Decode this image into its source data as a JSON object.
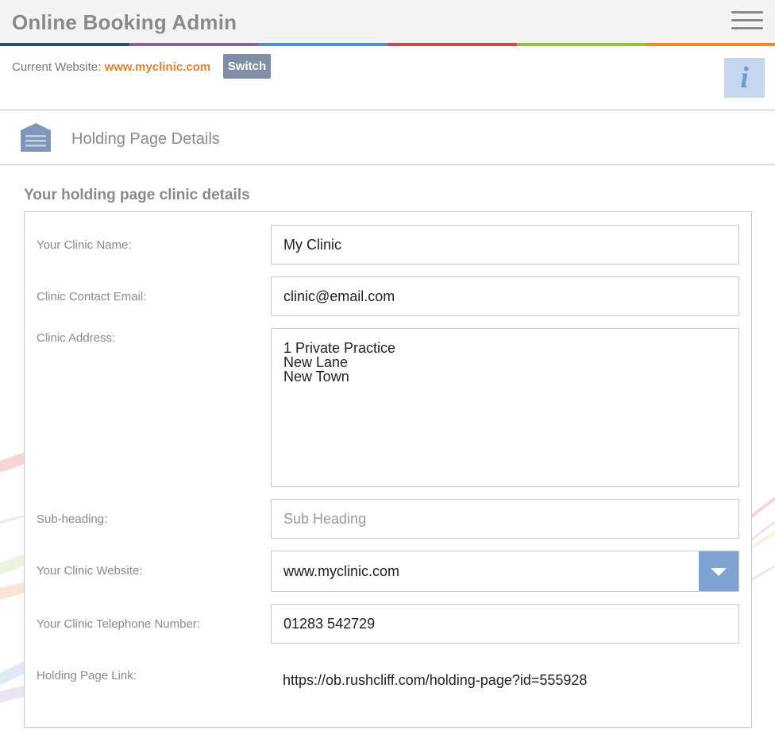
{
  "header": {
    "title": "Online Booking Admin",
    "menu_icon": "hamburger-menu-icon"
  },
  "stripe_colors": [
    "#2d4e7a",
    "#8a5fa8",
    "#4f8dd0",
    "#d6474a",
    "#8cc63f",
    "#f08a24"
  ],
  "website_bar": {
    "label": "Current Website:",
    "value": "www.myclinic.com",
    "switch_label": "Switch",
    "info_icon": "i"
  },
  "section": {
    "title": "Holding Page Details",
    "icon": "house-icon"
  },
  "form": {
    "heading": "Your holding page clinic details",
    "clinic_name": {
      "label": "Your Clinic Name:",
      "value": "My Clinic"
    },
    "contact_email": {
      "label": "Clinic Contact Email:",
      "value": "clinic@email.com"
    },
    "address": {
      "label": "Clinic Address:",
      "value": "1 Private Practice\nNew Lane\nNew Town"
    },
    "sub_heading": {
      "label": "Sub-heading:",
      "value": "",
      "placeholder": "Sub Heading"
    },
    "website": {
      "label": "Your Clinic Website:",
      "value": "www.myclinic.com"
    },
    "telephone": {
      "label": "Your Clinic Telephone Number:",
      "value": "01283 542729"
    },
    "holding_link": {
      "label": "Holding Page Link:",
      "value": "https://ob.rushcliff.com/holding-page?id=555928"
    }
  }
}
